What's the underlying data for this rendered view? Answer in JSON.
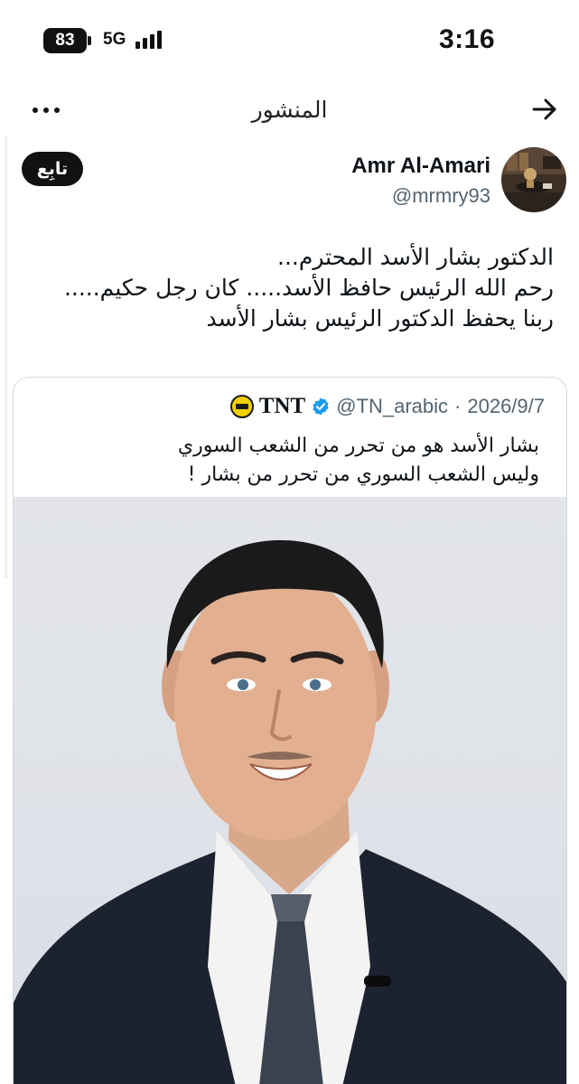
{
  "status_bar": {
    "battery": "83",
    "network": "5G",
    "time": "3:16"
  },
  "header": {
    "title": "المنشور"
  },
  "post": {
    "author_name": "Amr Al-Amari",
    "author_handle": "@mrmry93",
    "follow_label": "تابِع",
    "text_lines": [
      "الدكتور بشار الأسد المحترم...",
      "رحم الله الرئيس حافظ الأسد..... كان رجل حكيم.....",
      "ربنا يحفظ الدكتور الرئيس بشار الأسد"
    ]
  },
  "quote": {
    "name": "TNT",
    "handle": "@TN_arabic",
    "separator": "·",
    "date": "2026/9/7",
    "text_lines": [
      "بشار الأسد هو من تحرر من الشعب السوري",
      "وليس الشعب السوري من تحرر من بشار !"
    ]
  },
  "colors": {
    "text": "#0f1419",
    "secondary": "#536471",
    "verified": "#1d9bf0",
    "border": "#cfd9de",
    "follow_bg": "#111111"
  },
  "icons": {
    "back": "arrow-right-icon",
    "more": "more-dots-icon",
    "verified": "verified-badge-icon"
  }
}
